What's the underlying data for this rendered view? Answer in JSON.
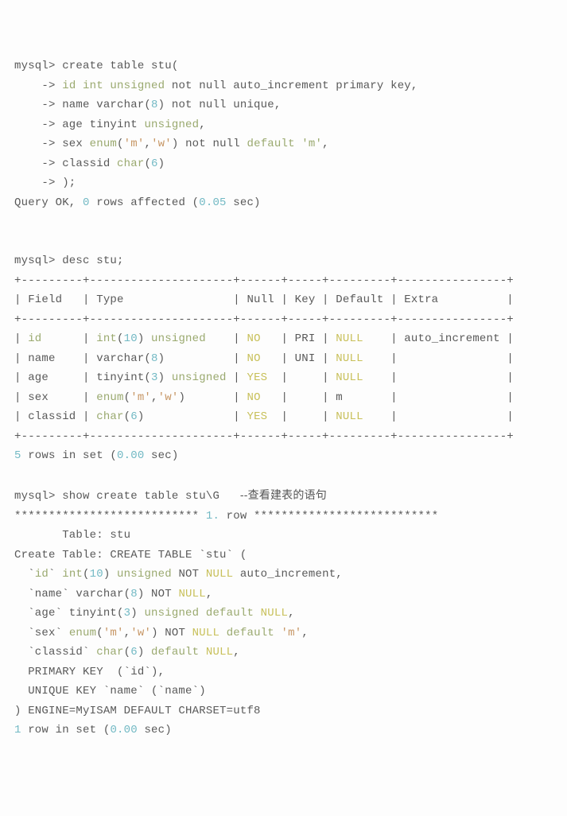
{
  "create": {
    "prompt": "mysql>",
    "cont": "    ->",
    "l0a": " create table stu(",
    "l1a": " ",
    "l1b": "id int unsigned",
    "l1c": " not null auto_increment primary key,",
    "l2a": " name varchar(",
    "l2n": "8",
    "l2b": ") not null unique,",
    "l3a": " age tinyint ",
    "l3b": "unsigned",
    "l3c": ",",
    "l4a": " sex ",
    "l4b": "enum",
    "l4c": "(",
    "l4s1": "'m'",
    "l4d": ",",
    "l4s2": "'w'",
    "l4e": ") not null ",
    "l4f": "default 'm'",
    "l4g": ",",
    "l5a": " classid ",
    "l5b": "char",
    "l5c": "(",
    "l5n": "6",
    "l5d": ")",
    "l6": " );",
    "result_a": "Query OK, ",
    "result_n": "0",
    "result_b": " rows affected (",
    "result_t": "0.05",
    "result_c": " sec)"
  },
  "desc": {
    "cmd": " desc stu;",
    "border": "+---------+---------------------+------+-----+---------+----------------+",
    "header": "| Field   | Type                | Null | Key | Default | Extra          |",
    "row_id_a": "| ",
    "row_id_f": "id",
    "row_id_b": "      | ",
    "row_id_t1": "int",
    "row_id_t2": "(",
    "row_id_tn": "10",
    "row_id_t3": ") ",
    "row_id_t4": "unsigned",
    "row_id_c": "    | ",
    "row_id_null": "NO",
    "row_id_d": "   | PRI | ",
    "row_id_def": "NULL",
    "row_id_e": "    | auto_increment |",
    "row_name_a": "| name    | varchar(",
    "row_name_n": "8",
    "row_name_b": ")          | ",
    "row_name_null": "NO",
    "row_name_c": "   | UNI | ",
    "row_name_def": "NULL",
    "row_name_d": "    |                |",
    "row_age_a": "| age     | tinyint(",
    "row_age_n": "3",
    "row_age_b": ") ",
    "row_age_u": "unsigned",
    "row_age_c": " | ",
    "row_age_null": "YES",
    "row_age_d": "  |     | ",
    "row_age_def": "NULL",
    "row_age_e": "    |                |",
    "row_sex_a": "| sex     | ",
    "row_sex_t": "enum",
    "row_sex_b": "(",
    "row_sex_s1": "'m'",
    "row_sex_c": ",",
    "row_sex_s2": "'w'",
    "row_sex_d": ")       | ",
    "row_sex_null": "NO",
    "row_sex_e": "   |     | m       |                |",
    "row_cls_a": "| classid | ",
    "row_cls_t": "char",
    "row_cls_b": "(",
    "row_cls_n": "6",
    "row_cls_c": ")             | ",
    "row_cls_null": "YES",
    "row_cls_d": "  |     | ",
    "row_cls_def": "NULL",
    "row_cls_e": "    |                |",
    "foot_n": "5",
    "foot_a": " rows in set (",
    "foot_t": "0.00",
    "foot_b": " sec)"
  },
  "show": {
    "cmd_a": " show create table stu\\G   ",
    "cmd_comment": "--查看建表的语句",
    "stars_a": "*************************** ",
    "stars_n": "1.",
    "stars_b": " row ***************************",
    "t1": "       Table: stu",
    "t2": "Create Table: CREATE TABLE `stu` (",
    "c1a": "  `",
    "c1f": "id",
    "c1b": "` ",
    "c1t": "int",
    "c1c": "(",
    "c1n": "10",
    "c1d": ") ",
    "c1u": "unsigned",
    "c1e": " NOT ",
    "c1null": "NULL",
    "c1g": " auto_increment,",
    "c2a": "  `name` varchar(",
    "c2n": "8",
    "c2b": ") NOT ",
    "c2null": "NULL",
    "c2c": ",",
    "c3a": "  `age` tinyint(",
    "c3n": "3",
    "c3b": ") ",
    "c3u": "unsigned default",
    "c3c": " ",
    "c3null": "NULL",
    "c3d": ",",
    "c4a": "  `sex` ",
    "c4t": "enum",
    "c4b": "(",
    "c4s1": "'m'",
    "c4c": ",",
    "c4s2": "'w'",
    "c4d": ") NOT ",
    "c4null": "NULL",
    "c4e": " ",
    "c4def": "default",
    "c4f": " ",
    "c4s3": "'m'",
    "c4g": ",",
    "c5a": "  `classid` ",
    "c5t": "char",
    "c5b": "(",
    "c5n": "6",
    "c5c": ") ",
    "c5def": "default",
    "c5d": " ",
    "c5null": "NULL",
    "c5e": ",",
    "c6": "  PRIMARY KEY  (`id`),",
    "c7": "  UNIQUE KEY `name` (`name`)",
    "c8": ") ENGINE=MyISAM DEFAULT CHARSET=utf8",
    "foot_n": "1",
    "foot_a": " row in set (",
    "foot_t": "0.00",
    "foot_b": " sec)"
  }
}
